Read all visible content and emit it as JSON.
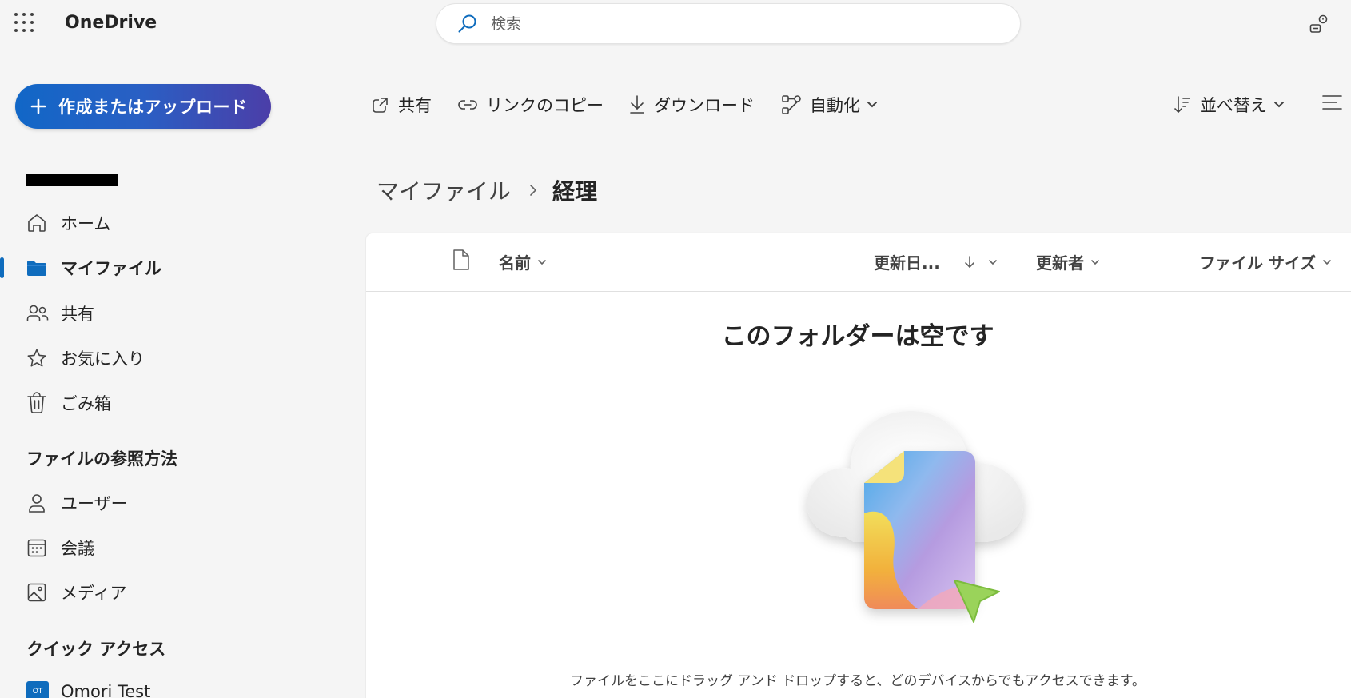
{
  "app": {
    "name": "OneDrive"
  },
  "search": {
    "placeholder": "検索"
  },
  "create_button": {
    "label": "作成またはアップロード"
  },
  "toolbar": {
    "share": "共有",
    "copy_link": "リンクのコピー",
    "download": "ダウンロード",
    "automate": "自動化",
    "sort": "並べ替え"
  },
  "sidebar": {
    "items": [
      {
        "label": "ホーム",
        "icon": "home-icon"
      },
      {
        "label": "マイファイル",
        "icon": "folder-icon",
        "selected": true
      },
      {
        "label": "共有",
        "icon": "people-icon"
      },
      {
        "label": "お気に入り",
        "icon": "star-icon"
      },
      {
        "label": "ごみ箱",
        "icon": "trash-icon"
      }
    ],
    "browse_title": "ファイルの参照方法",
    "browse_items": [
      {
        "label": "ユーザー",
        "icon": "person-icon"
      },
      {
        "label": "会議",
        "icon": "calendar-icon"
      },
      {
        "label": "メディア",
        "icon": "image-icon"
      }
    ],
    "quick_access_title": "クイック アクセス",
    "quick_access_items": [
      {
        "label": "Omori Test",
        "initials": "OT"
      }
    ]
  },
  "breadcrumb": {
    "root": "マイファイル",
    "current": "経理"
  },
  "list": {
    "columns": {
      "name": "名前",
      "modified": "更新日...",
      "modified_by": "更新者",
      "size": "ファイル サイズ"
    }
  },
  "empty_state": {
    "title": "このフォルダーは空です",
    "description": "ファイルをここにドラッグ アンド ドロップすると、どのデバイスからでもアクセスできます。"
  },
  "colors": {
    "accent": "#0f6cbd",
    "create_gradient_start": "#1167c7",
    "create_gradient_end": "#4b3ea8"
  }
}
